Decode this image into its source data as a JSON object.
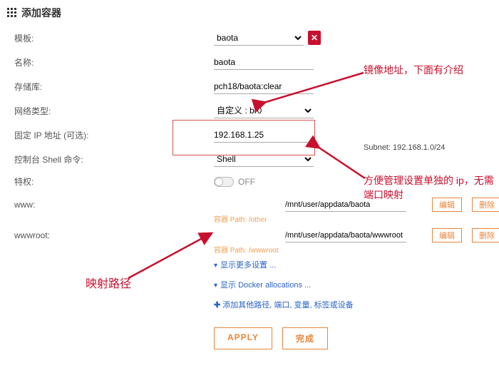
{
  "header": {
    "title": "添加容器"
  },
  "fields": {
    "template_label": "模板:",
    "template_value": "baota",
    "name_label": "名称:",
    "name_value": "baota",
    "repo_label": "存储库:",
    "repo_value": "pch18/baota:clear",
    "network_label": "网络类型:",
    "network_value": "自定义 : br0",
    "fixed_ip_label": "固定 IP 地址 (可选):",
    "fixed_ip_value": "192.168.1.25",
    "subnet_label": "Subnet: 192.168.1.0/24",
    "console_label": "控制台 Shell 命令:",
    "console_value": "Shell",
    "privileged_label": "特权:",
    "privileged_off": "OFF",
    "www_label": "www:",
    "www_value": "/mnt/user/appdata/baota",
    "www_container": "容器 Path: /other",
    "wwwroot_label": "wwwroot:",
    "wwwroot_value": "/mnt/user/appdata/baota/wwwroot",
    "wwwroot_container": "容器 Path: /wwwroot"
  },
  "buttons": {
    "edit": "编辑",
    "delete": "删除",
    "show_more": "显示更多设置 ...",
    "show_docker": "显示 Docker allocations ...",
    "add_other": "添加其他路径, 端口, 变量, 标签或设备",
    "apply": "APPLY",
    "done": "完成"
  },
  "annotations": {
    "image_addr": "镜像地址，下面有介绍",
    "ip_note": "方便管理设置单独的 ip，无需端口映射",
    "map_path": "映射路径"
  }
}
